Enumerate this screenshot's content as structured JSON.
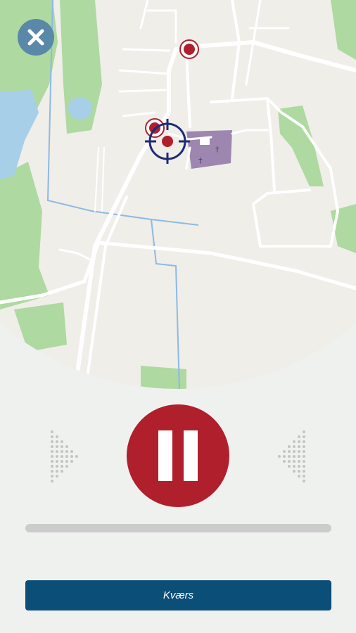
{
  "map": {
    "markers": [
      {
        "name": "poi-marker-north"
      },
      {
        "name": "poi-marker-center"
      }
    ],
    "current_location": {
      "name": "current-location-crosshair"
    },
    "colors": {
      "land": "#efeee9",
      "park": "#aed9a0",
      "water": "#a8cfe8",
      "road": "#ffffff",
      "stream": "#8fb8e3",
      "cemetery": "#9d86b0",
      "marker": "#b01f2c",
      "crosshair": "#1f2a78"
    }
  },
  "controls": {
    "close_icon": "close-icon",
    "prev_icon": "previous-arrow-icon",
    "next_icon": "next-arrow-icon",
    "pause_icon": "pause-icon",
    "progress": 0.0,
    "colors": {
      "accent": "#b01f2c",
      "primary": "#0b4e78",
      "close": "#5a88a8"
    }
  },
  "bottom_button": {
    "label": "Kværs"
  }
}
